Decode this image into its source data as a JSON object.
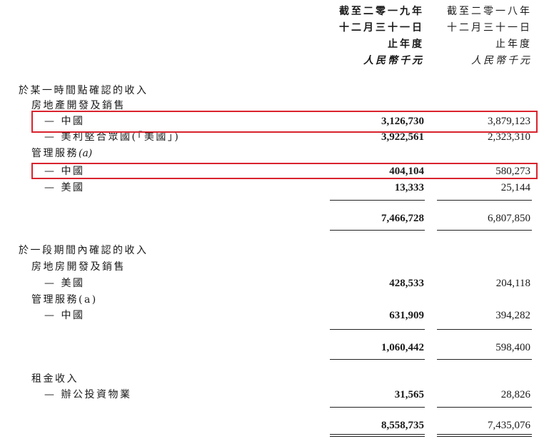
{
  "header": {
    "col1_line1": "截至二零一九年",
    "col1_line2": "十二月三十一日",
    "col1_line3": "止年度",
    "col1_line4": "人民幣千元",
    "col2_line1": "截至二零一八年",
    "col2_line2": "十二月三十一日",
    "col2_line3": "止年度",
    "col2_line4": "人民幣千元"
  },
  "section1": {
    "title": "於某一時間點確認的收入",
    "sub1": "房地產開發及銷售",
    "row1": {
      "label": "— 中國",
      "v2019": "3,126,730",
      "v2018": "3,879,123"
    },
    "row2": {
      "label": "— 美利堅合眾國(「美國」)",
      "v2019": "3,922,561",
      "v2018": "2,323,310"
    },
    "sub2": "管理服務",
    "sub2_note": "(a)",
    "row3": {
      "label": "— 中國",
      "v2019": "404,104",
      "v2018": "580,273"
    },
    "row4": {
      "label": "— 美國",
      "v2019": "13,333",
      "v2018": "25,144"
    },
    "total": {
      "v2019": "7,466,728",
      "v2018": "6,807,850"
    }
  },
  "section2": {
    "title": "於一段期間內確認的收入",
    "sub1": "房地房開發及銷售",
    "row1": {
      "label": "— 美國",
      "v2019": "428,533",
      "v2018": "204,118"
    },
    "sub2": "管理服務(a)",
    "row2": {
      "label": "— 中國",
      "v2019": "631,909",
      "v2018": "394,282"
    },
    "total": {
      "v2019": "1,060,442",
      "v2018": "598,400"
    }
  },
  "section3": {
    "title": "租金收入",
    "row1": {
      "label": "— 辦公投資物業",
      "v2019": "31,565",
      "v2018": "28,826"
    }
  },
  "grand_total": {
    "v2019": "8,558,735",
    "v2018": "7,435,076"
  },
  "highlight_color": "#d9232e"
}
